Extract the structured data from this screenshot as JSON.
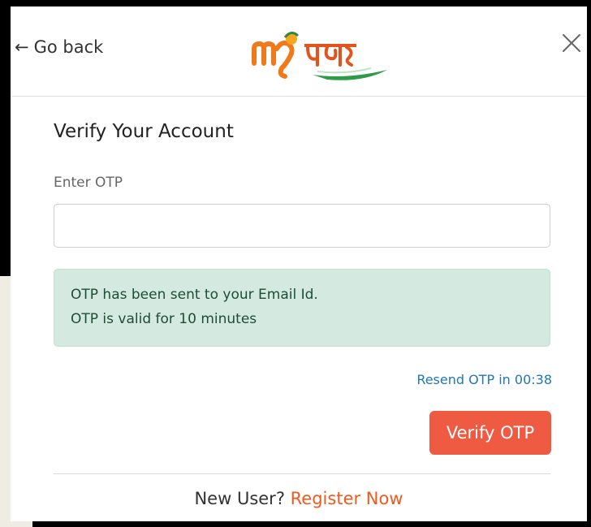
{
  "header": {
    "back_label": "Go back",
    "back_icon": "arrow-left-icon",
    "logo_icon": "my-bharat-logo",
    "close_icon": "close-icon"
  },
  "form": {
    "title": "Verify Your Account",
    "otp_label": "Enter OTP",
    "otp_value": "",
    "alert_line1": "OTP has been sent to your Email Id.",
    "alert_line2": "OTP is valid for 10 minutes",
    "resend_text": "Resend OTP in 00:38",
    "verify_label": "Verify OTP"
  },
  "footer": {
    "prompt": "New User?",
    "register_label": "Register Now"
  },
  "colors": {
    "accent": "#ef5a43",
    "link": "#1f77b8",
    "alert_bg": "#d4e9df",
    "register": "#ef5a1e"
  }
}
